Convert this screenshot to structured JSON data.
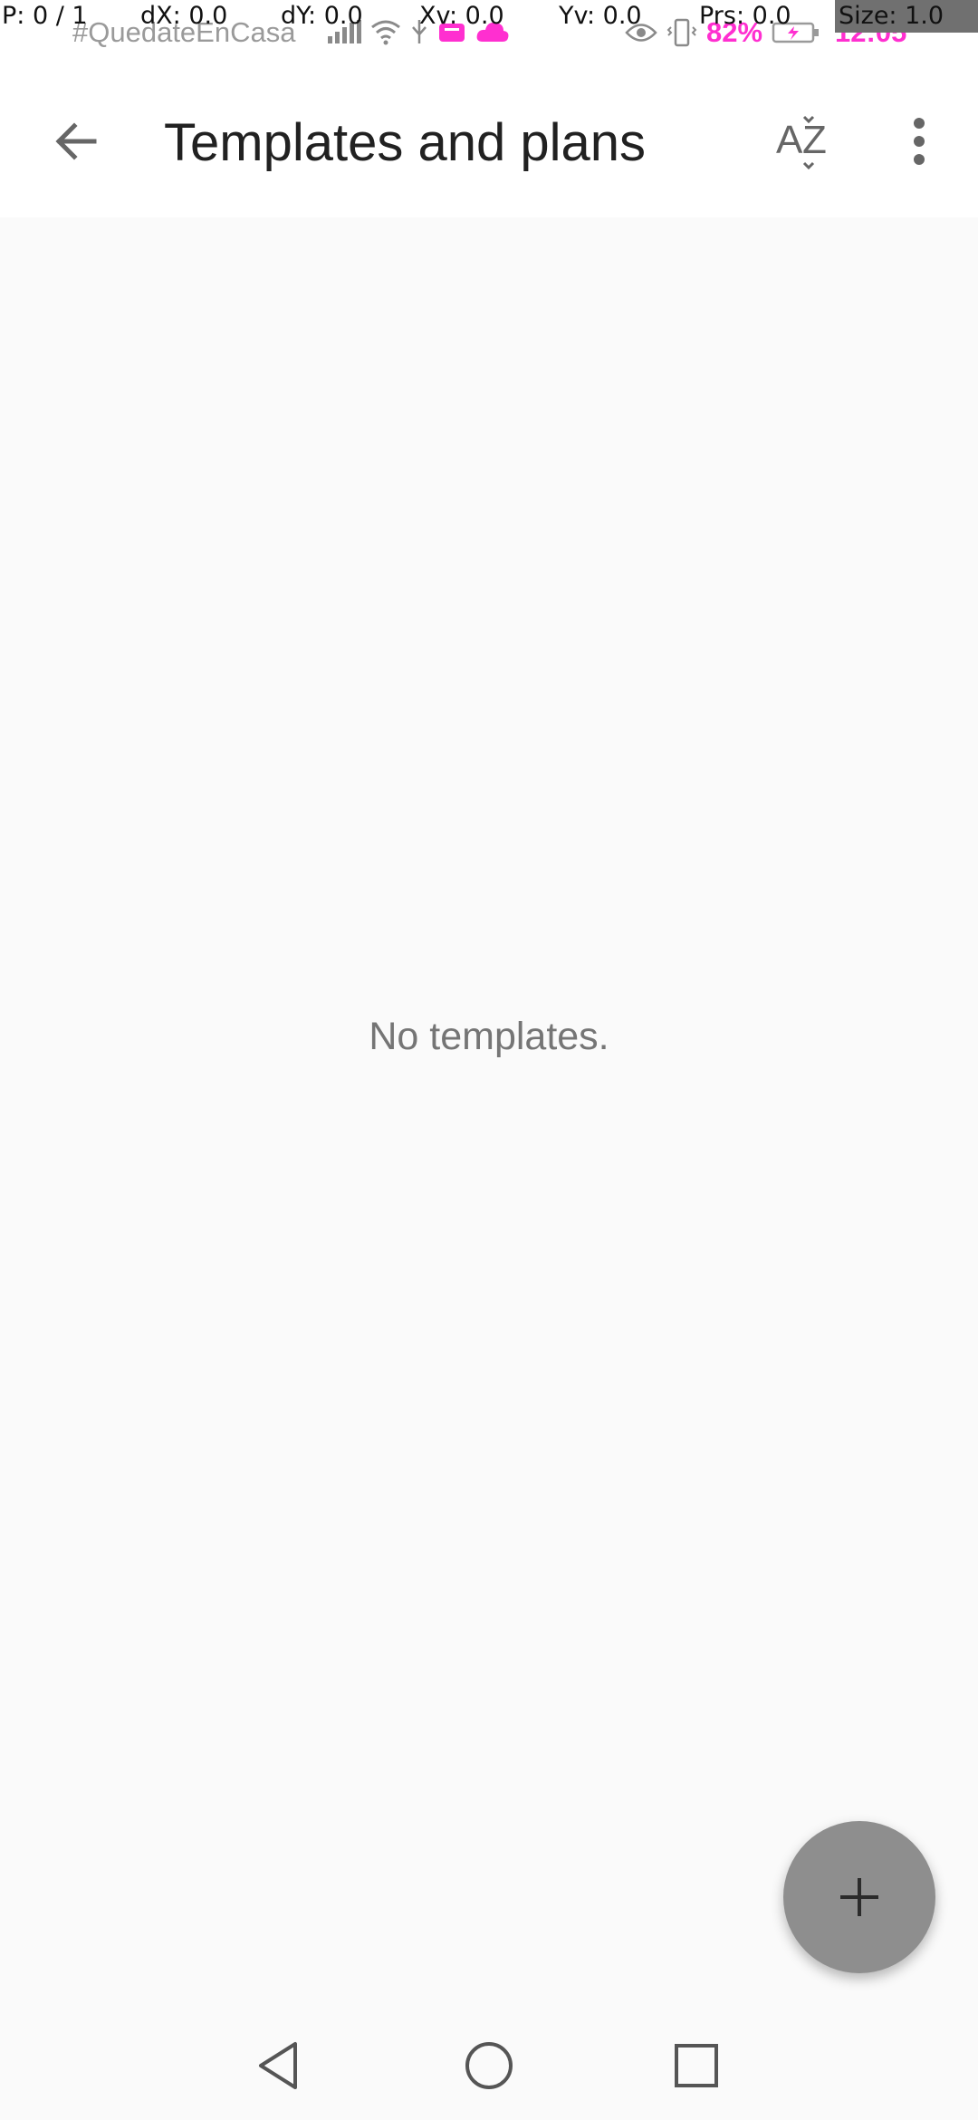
{
  "status_bar": {
    "tag": "#QuedateEnCasa",
    "battery_percent": "82%",
    "time": "12:05",
    "icons": [
      "signal-icon",
      "wifi-icon",
      "usb-icon",
      "app-notification-icon",
      "cloud-icon",
      "eye-icon",
      "vibrate-icon",
      "battery-icon"
    ]
  },
  "debug_overlay": {
    "pointer": "P: 0 / 1",
    "dx": "dX: 0.0",
    "dy": "dY: 0.0",
    "xv": "Xv: 0.0",
    "yv": "Yv: 0.0",
    "prs": "Prs: 0.0",
    "size": "Size: 1.0"
  },
  "app_bar": {
    "title": "Templates and plans",
    "back_icon": "arrow-back-icon",
    "sort_icon": "sort-az-icon",
    "more_icon": "more-vert-icon"
  },
  "content": {
    "empty_message": "No templates."
  },
  "fab": {
    "icon": "plus-icon"
  },
  "nav_bar": {
    "icons": [
      "back-triangle-icon",
      "home-circle-icon",
      "recents-square-icon"
    ]
  },
  "colors": {
    "accent_status": "#ff2fd0",
    "fab": "#8e8e8e",
    "background": "#fafafa",
    "appbar": "#ffffff",
    "title": "#212121",
    "muted_text": "#757575"
  }
}
